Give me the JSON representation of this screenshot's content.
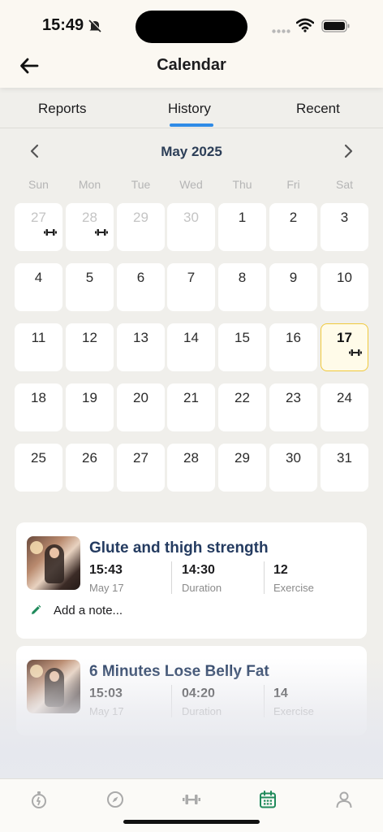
{
  "status_bar": {
    "time": "15:49"
  },
  "header": {
    "title": "Calendar"
  },
  "tabs": [
    {
      "label": "Reports"
    },
    {
      "label": "History",
      "active": true
    },
    {
      "label": "Recent"
    }
  ],
  "calendar": {
    "month_label": "May 2025",
    "weekdays": [
      "Sun",
      "Mon",
      "Tue",
      "Wed",
      "Thu",
      "Fri",
      "Sat"
    ],
    "weeks": [
      [
        "27",
        "28",
        "29",
        "30",
        "1",
        "2",
        "3"
      ],
      [
        "4",
        "5",
        "6",
        "7",
        "8",
        "9",
        "10"
      ],
      [
        "11",
        "12",
        "13",
        "14",
        "15",
        "16",
        "17"
      ],
      [
        "18",
        "19",
        "20",
        "21",
        "22",
        "23",
        "24"
      ],
      [
        "25",
        "26",
        "27",
        "28",
        "29",
        "30",
        "31"
      ]
    ],
    "other_month_days": [
      "27",
      "28",
      "29",
      "30"
    ],
    "workout_days": [
      "27 (Apr)",
      "28 (Apr)",
      "17"
    ],
    "today": "17"
  },
  "workouts": [
    {
      "title": "Glute and thigh strength",
      "time": "15:43",
      "date": "May 17",
      "duration": "14:30",
      "duration_label": "Duration",
      "exercise_count": "12",
      "exercise_label": "Exercise",
      "note_placeholder": "Add a note..."
    },
    {
      "title": "6 Minutes Lose Belly Fat",
      "time": "15:03",
      "date": "May 17",
      "duration": "04:20",
      "duration_label": "Duration",
      "exercise_count": "14",
      "exercise_label": "Exercise"
    }
  ],
  "bottom_nav": [
    {
      "icon": "stopwatch-icon"
    },
    {
      "icon": "compass-icon"
    },
    {
      "icon": "dumbbell-icon"
    },
    {
      "icon": "calendar-icon",
      "active": true
    },
    {
      "icon": "profile-icon"
    }
  ],
  "colors": {
    "accent_blue": "#2f8be6",
    "today_border": "#f0c93c",
    "active_nav": "#1f8a5b",
    "title_navy": "#243b60"
  }
}
